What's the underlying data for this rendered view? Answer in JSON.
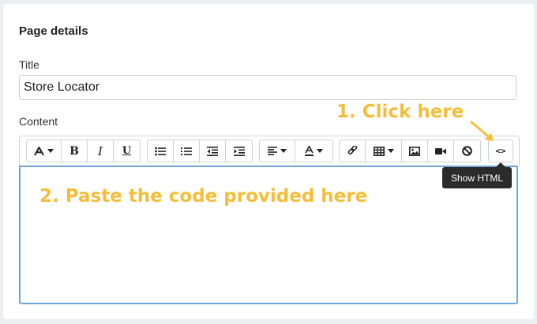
{
  "section": {
    "title": "Page details"
  },
  "title_field": {
    "label": "Title",
    "value": "Store Locator"
  },
  "content_field": {
    "label": "Content"
  },
  "toolbar": {
    "bold_label": "B",
    "italic_label": "I",
    "underline_label": "U",
    "show_html_label": "<>",
    "icons": [
      "text-style",
      "bold",
      "italic",
      "underline",
      "bullet-list",
      "numbered-list",
      "outdent",
      "indent",
      "align",
      "text-color",
      "link",
      "table",
      "image",
      "video",
      "clear-formatting",
      "show-html"
    ]
  },
  "annotations": {
    "step1": "1. Click here",
    "step2": "2. Paste the code provided here"
  },
  "tooltip": {
    "text": "Show HTML"
  },
  "colors": {
    "annotation": "#f5be3a",
    "editor_focus": "#6aa6dc",
    "tooltip_bg": "#2b2b2b"
  }
}
